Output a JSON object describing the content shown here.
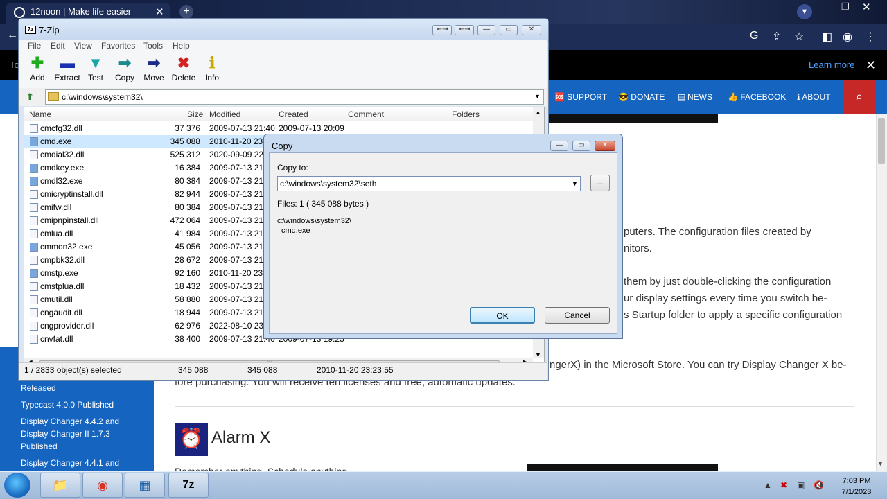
{
  "browser": {
    "tab_title": "12noon | Make life easier",
    "notification_text": "To",
    "learn_more": "Learn more",
    "nav_items": [
      "🆘 SUPPORT",
      "😎 DONATE",
      "NEWS",
      "👍 FACEBOOK",
      "ℹ ABOUT"
    ],
    "sidebar_items": [
      "Released",
      "Typecast 4.0.0 Published",
      "Display Changer 4.4.2 and",
      "Display Changer II 1.7.3",
      "Published",
      "Display Changer 4.4.1 and"
    ],
    "paragraphs": [
      "puters. The configuration files created by",
      "nitors.",
      "them by just double-clicking the configuration",
      "ur display settings every time you switch be-",
      "s Startup folder to apply a specific configuration",
      "ngerX) in the Microsoft Store. You can try Display Changer X be-",
      "fore purchasing. You will receive ten licenses and free, automatic updates."
    ],
    "section_title": "Alarm X",
    "section_desc": "Remember anything. Schedule anything."
  },
  "zip": {
    "title": "7-Zip",
    "menu": [
      "File",
      "Edit",
      "View",
      "Favorites",
      "Tools",
      "Help"
    ],
    "toolbar": [
      {
        "label": "Add",
        "icon": "+",
        "color": "#1faa1f"
      },
      {
        "label": "Extract",
        "icon": "−",
        "color": "#1a2fb0"
      },
      {
        "label": "Test",
        "icon": "✔",
        "color": "#1aa5a5"
      },
      {
        "label": "Copy",
        "icon": "➜",
        "color": "#1a8a8a"
      },
      {
        "label": "Move",
        "icon": "➜",
        "color": "#1a2b8a"
      },
      {
        "label": "Delete",
        "icon": "✖",
        "color": "#d32222"
      },
      {
        "label": "Info",
        "icon": "i",
        "color": "#c8a800"
      }
    ],
    "path": "c:\\windows\\system32\\",
    "columns": [
      "Name",
      "Size",
      "Modified",
      "Created",
      "Comment",
      "Folders"
    ],
    "files": [
      {
        "name": "cmcfg32.dll",
        "size": "37 376",
        "modified": "2009-07-13 21:40",
        "created": "2009-07-13 20:09",
        "type": "dll"
      },
      {
        "name": "cmd.exe",
        "size": "345 088",
        "modified": "2010-11-20 23:2",
        "created": "",
        "type": "exe"
      },
      {
        "name": "cmdial32.dll",
        "size": "525 312",
        "modified": "2020-09-09 22:",
        "created": "",
        "type": "dll"
      },
      {
        "name": "cmdkey.exe",
        "size": "16 384",
        "modified": "2009-07-13 21:3",
        "created": "",
        "type": "exe"
      },
      {
        "name": "cmdl32.exe",
        "size": "80 384",
        "modified": "2009-07-13 21:3",
        "created": "",
        "type": "exe"
      },
      {
        "name": "cmicryptinstall.dll",
        "size": "82 944",
        "modified": "2009-07-13 21:4",
        "created": "",
        "type": "dll"
      },
      {
        "name": "cmifw.dll",
        "size": "80 384",
        "modified": "2009-07-13 21:4",
        "created": "",
        "type": "dll"
      },
      {
        "name": "cmipnpinstall.dll",
        "size": "472 064",
        "modified": "2009-07-13 21:4",
        "created": "",
        "type": "dll"
      },
      {
        "name": "cmlua.dll",
        "size": "41 984",
        "modified": "2009-07-13 21:4",
        "created": "",
        "type": "dll"
      },
      {
        "name": "cmmon32.exe",
        "size": "45 056",
        "modified": "2009-07-13 21:3",
        "created": "",
        "type": "exe"
      },
      {
        "name": "cmpbk32.dll",
        "size": "28 672",
        "modified": "2009-07-13 21:4",
        "created": "",
        "type": "dll"
      },
      {
        "name": "cmstp.exe",
        "size": "92 160",
        "modified": "2010-11-20 23:2",
        "created": "",
        "type": "exe"
      },
      {
        "name": "cmstplua.dll",
        "size": "18 432",
        "modified": "2009-07-13 21:4",
        "created": "",
        "type": "dll"
      },
      {
        "name": "cmutil.dll",
        "size": "58 880",
        "modified": "2009-07-13 21:4",
        "created": "",
        "type": "dll"
      },
      {
        "name": "cngaudit.dll",
        "size": "18 944",
        "modified": "2009-07-13 21:4",
        "created": "",
        "type": "dll"
      },
      {
        "name": "cngprovider.dll",
        "size": "62 976",
        "modified": "2022-08-10 23:2",
        "created": "",
        "type": "dll"
      },
      {
        "name": "cnvfat.dll",
        "size": "38 400",
        "modified": "2009-07-13 21:40",
        "created": "2009-07-13 19:25",
        "type": "dll"
      }
    ],
    "status": {
      "selected": "1 / 2833 object(s) selected",
      "size": "345 088",
      "packed": "345 088",
      "date": "2010-11-20 23:23:55"
    }
  },
  "copy_dialog": {
    "title": "Copy",
    "copy_to_label": "Copy to:",
    "destination": "c:\\windows\\system32\\seth",
    "browse": "...",
    "files_info": "Files: 1     ( 345 088 bytes )",
    "source_path": "c:\\windows\\system32\\",
    "source_file": "cmd.exe",
    "ok": "OK",
    "cancel": "Cancel"
  },
  "taskbar": {
    "time": "7:03 PM",
    "date": "7/1/2023",
    "apps": [
      "📁",
      "◉",
      "▦",
      "7z"
    ]
  }
}
